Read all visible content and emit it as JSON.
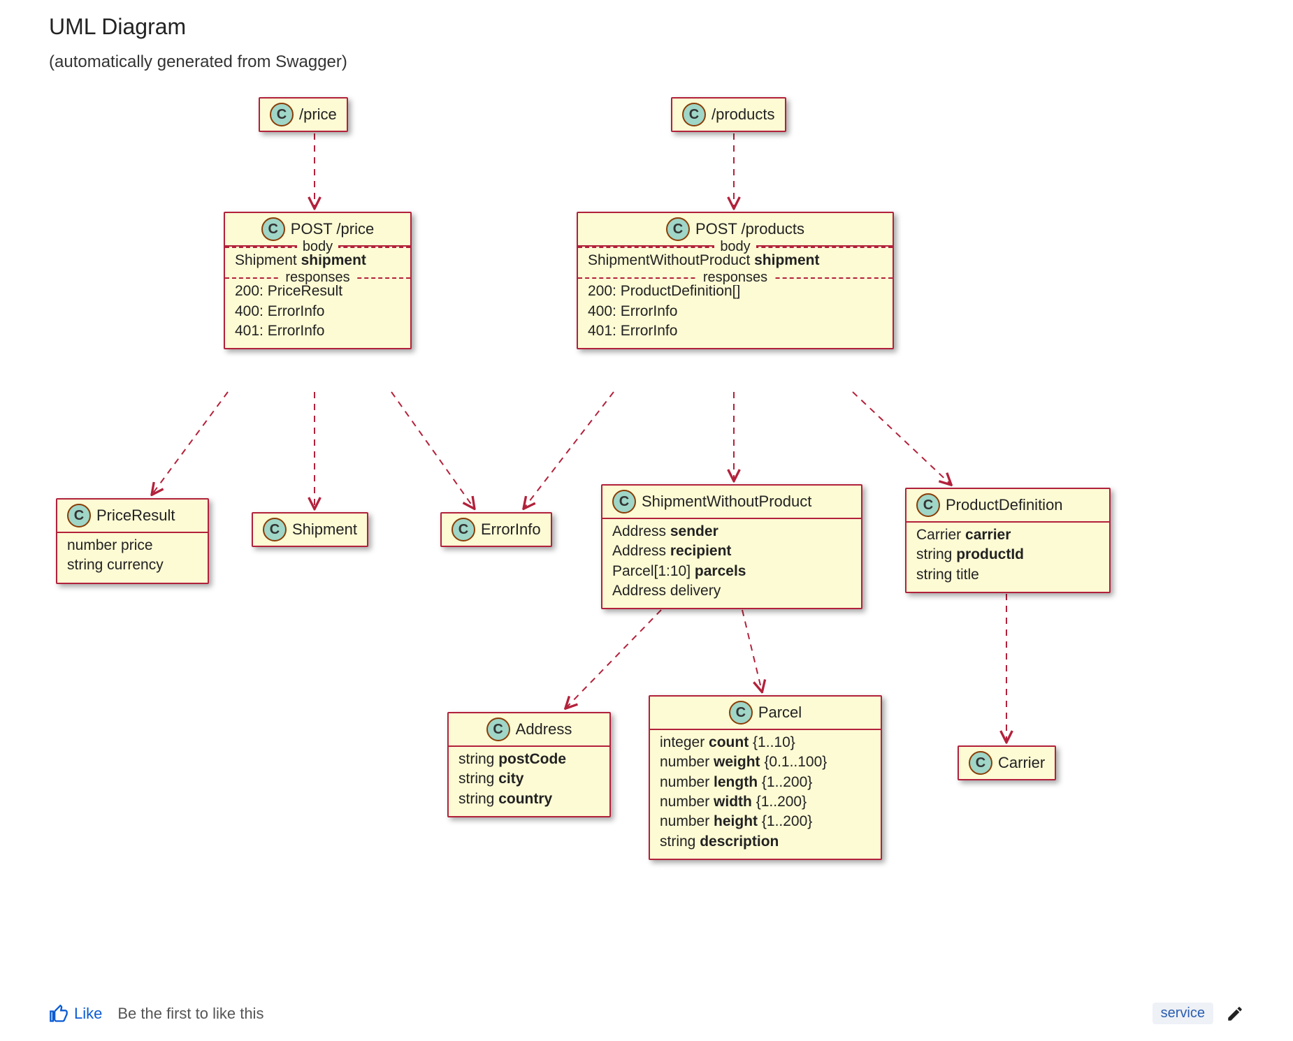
{
  "page": {
    "title": "UML Diagram",
    "subtitle": "(automatically generated from Swagger)"
  },
  "boxes": {
    "price_root": {
      "label": "/price"
    },
    "products_root": {
      "label": "/products"
    },
    "post_price": {
      "title": "POST /price",
      "body_section": "body",
      "body_line": "Shipment shipment",
      "resp_section": "responses",
      "resp_200": "200: PriceResult",
      "resp_400": "400: ErrorInfo",
      "resp_401": "401: ErrorInfo"
    },
    "post_products": {
      "title": "POST /products",
      "body_section": "body",
      "body_line": "ShipmentWithoutProduct shipment",
      "resp_section": "responses",
      "resp_200": "200: ProductDefinition[]",
      "resp_400": "400: ErrorInfo",
      "resp_401": "401: ErrorInfo"
    },
    "price_result": {
      "title": "PriceResult",
      "l1": "number price",
      "l2": "string currency"
    },
    "shipment": {
      "title": "Shipment"
    },
    "errorinfo": {
      "title": "ErrorInfo"
    },
    "swp": {
      "title": "ShipmentWithoutProduct",
      "l1": "Address sender",
      "l2": "Address recipient",
      "l3": "Parcel[1:10] parcels",
      "l4": "Address delivery"
    },
    "productdef": {
      "title": "ProductDefinition",
      "l1": "Carrier carrier",
      "l2": "string productId",
      "l3": "string title"
    },
    "address": {
      "title": "Address",
      "l1": "string postCode",
      "l2": "string city",
      "l3": "string country"
    },
    "parcel": {
      "title": "Parcel",
      "l1": "integer count {1..10}",
      "l2": "number weight {0.1..100}",
      "l3": "number length {1..200}",
      "l4": "number width {1..200}",
      "l5": "number height {1..200}",
      "l6": "string description"
    },
    "carrier": {
      "title": "Carrier"
    }
  },
  "footer": {
    "like": "Like",
    "rest": "Be the first to like this",
    "tag": "service"
  },
  "relations": [
    {
      "from": "/price",
      "to": "POST /price",
      "style": "dashed"
    },
    {
      "from": "/products",
      "to": "POST /products",
      "style": "dashed"
    },
    {
      "from": "POST /price",
      "to": "PriceResult",
      "style": "dashed"
    },
    {
      "from": "POST /price",
      "to": "Shipment",
      "style": "dashed"
    },
    {
      "from": "POST /price",
      "to": "ErrorInfo",
      "style": "dashed"
    },
    {
      "from": "POST /products",
      "to": "ErrorInfo",
      "style": "dashed"
    },
    {
      "from": "POST /products",
      "to": "ShipmentWithoutProduct",
      "style": "dashed"
    },
    {
      "from": "POST /products",
      "to": "ProductDefinition",
      "style": "dashed"
    },
    {
      "from": "ShipmentWithoutProduct",
      "to": "Address",
      "style": "dashed"
    },
    {
      "from": "ShipmentWithoutProduct",
      "to": "Parcel",
      "style": "dashed"
    },
    {
      "from": "ProductDefinition",
      "to": "Carrier",
      "style": "dashed"
    }
  ]
}
